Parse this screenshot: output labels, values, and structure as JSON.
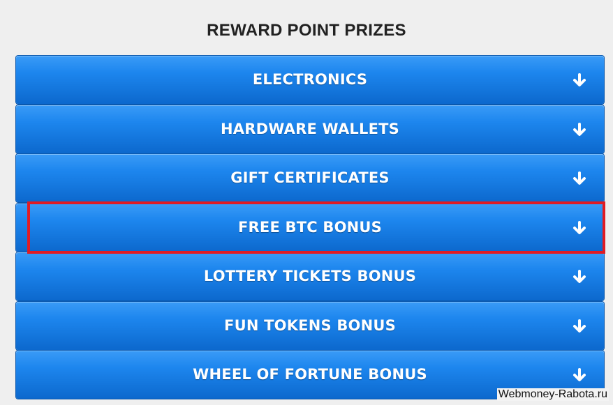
{
  "page": {
    "title": "REWARD POINT PRIZES",
    "watermark": "Webmoney-Rabota.ru"
  },
  "accordion": {
    "items": [
      {
        "label": "ELECTRONICS",
        "icon": "arrow-down-icon"
      },
      {
        "label": "HARDWARE WALLETS",
        "icon": "arrow-down-icon"
      },
      {
        "label": "GIFT CERTIFICATES",
        "icon": "arrow-down-icon"
      },
      {
        "label": "FREE BTC BONUS",
        "icon": "arrow-down-icon",
        "highlighted": true
      },
      {
        "label": "LOTTERY TICKETS BONUS",
        "icon": "arrow-down-icon"
      },
      {
        "label": "FUN TOKENS BONUS",
        "icon": "arrow-down-icon"
      },
      {
        "label": "WHEEL OF FORTUNE BONUS",
        "icon": "arrow-down-icon"
      }
    ]
  },
  "colors": {
    "button_top": "#3a9bf7",
    "button_bottom": "#0c68cd",
    "highlight_border": "#e01b24",
    "background": "#efefef"
  }
}
